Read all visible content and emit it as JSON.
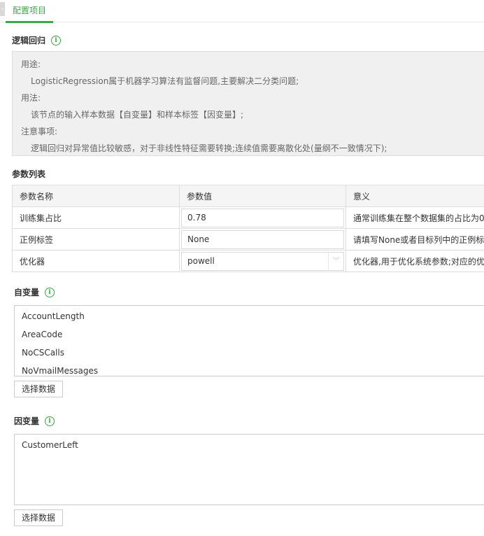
{
  "tab": {
    "label": "配置项目"
  },
  "algorithm": {
    "title": "逻辑回归",
    "desc": {
      "usage_heading": "用途:",
      "usage_text": "LogisticRegression属于机器学习算法有监督问题,主要解决二分类问题;",
      "method_heading": "用法:",
      "method_text": "该节点的输入样本数据【自变量】和样本标签【因变量】;",
      "notes_heading": "注意事项:",
      "notes_text": "逻辑回归对异常值比较敏感，对于非线性特征需要转换;连续值需要离散化处(量纲不一致情况下);"
    }
  },
  "params": {
    "title": "参数列表",
    "headers": {
      "name": "参数名称",
      "value": "参数值",
      "meaning": "意义"
    },
    "rows": [
      {
        "name": "训练集占比",
        "value": "0.78",
        "meaning": "通常训练集在整个数据集的占比为0"
      },
      {
        "name": "正例标签",
        "value": "None",
        "meaning": "请填写None或者目标列中的正例标签"
      },
      {
        "name": "优化器",
        "value": "powell",
        "meaning": "优化器,用于优化系统参数;对应的优化"
      }
    ]
  },
  "independent": {
    "title": "自变量",
    "items": [
      "AccountLength",
      "AreaCode",
      "NoCSCalls",
      "NoVmailMessages"
    ],
    "button": "选择数据"
  },
  "dependent": {
    "title": "因变量",
    "items": [
      "CustomerLeft"
    ],
    "button": "选择数据"
  },
  "theme": {
    "accent": "#3aa845"
  }
}
